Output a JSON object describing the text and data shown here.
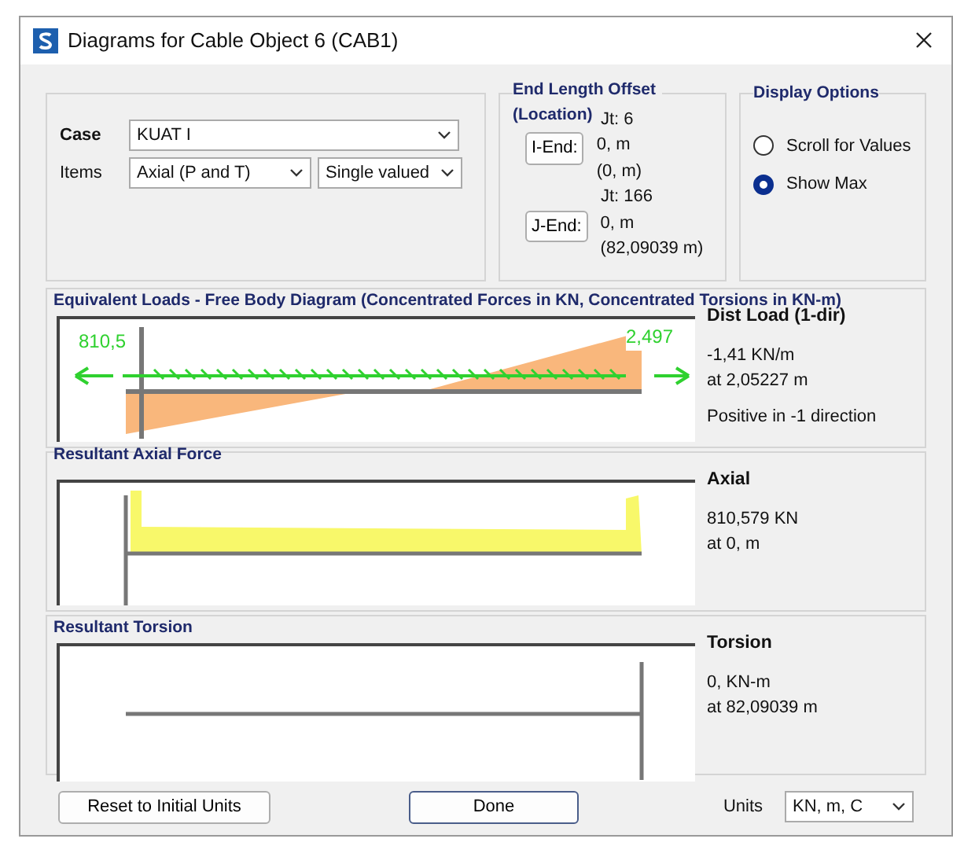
{
  "window": {
    "title": "Diagrams for Cable Object 6  (CAB1)"
  },
  "case": {
    "label": "Case",
    "value": "KUAT I"
  },
  "items": {
    "label": "Items",
    "value": "Axial (P and T)",
    "mode": "Single valued"
  },
  "end_length_offset": {
    "title": "End Length Offset",
    "subtitle": "(Location)",
    "ends": [
      {
        "button": "I-End:",
        "joint": "Jt:  6",
        "values": [
          "0, m",
          "(0, m)"
        ]
      },
      {
        "button": "J-End:",
        "joint": "Jt:  166",
        "values": [
          "0, m",
          "(82,09039 m)"
        ]
      }
    ]
  },
  "display_options": {
    "title": "Display Options",
    "options": [
      {
        "label": "Scroll for Values",
        "selected": false
      },
      {
        "label": "Show Max",
        "selected": true
      }
    ]
  },
  "panels": [
    {
      "kind": "loads",
      "title": "Equivalent Loads - Free Body Diagram  (Concentrated Forces in KN, Concentrated Torsions in KN-m)",
      "left_label": "810,5",
      "right_label": "2,497",
      "heading": "Dist Load (1-dir)",
      "lines": [
        "-1,41 KN/m",
        "at 2,05227 m",
        "Positive in -1 direction"
      ]
    },
    {
      "kind": "axial",
      "title": "Resultant Axial Force",
      "heading": "Axial",
      "lines": [
        "810,579 KN",
        "at 0, m"
      ]
    },
    {
      "kind": "torsion",
      "title": "Resultant Torsion",
      "heading": "Torsion",
      "lines": [
        "0, KN-m",
        "at 82,09039 m"
      ]
    }
  ],
  "footer": {
    "reset": "Reset to Initial Units",
    "done": "Done",
    "units_label": "Units",
    "units": "KN, m, C"
  }
}
